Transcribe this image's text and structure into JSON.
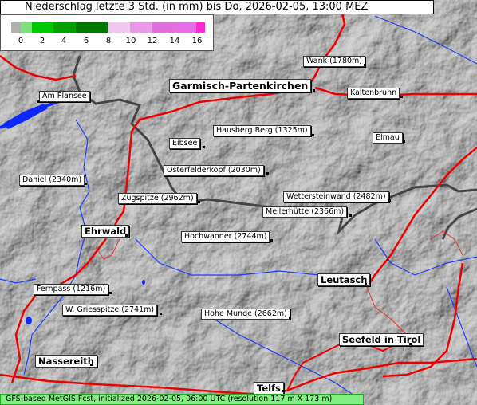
{
  "header": {
    "title": "Niederschlag letzte 3 Std. (in mm) bis Do, 2026-02-05, 13:00 MEZ"
  },
  "legend": {
    "ticks": [
      "0",
      "2",
      "4",
      "6",
      "8",
      "10",
      "12",
      "14",
      "16"
    ],
    "colors": [
      "#b0b0b0",
      "#7ee07e",
      "#00c800",
      "#00a000",
      "#007800",
      "#f0c8f0",
      "#e89ae8",
      "#e070e0",
      "#ff28d0"
    ]
  },
  "places": [
    {
      "id": "wank",
      "text": "Wank (1780m)",
      "style": "small"
    },
    {
      "id": "garmisch",
      "text": "Garmisch-Partenkirchen",
      "style": "huge"
    },
    {
      "id": "kaltenbrunn",
      "text": "Kaltenbrunn",
      "style": "small"
    },
    {
      "id": "plansee",
      "text": "Am Plansee",
      "style": "small"
    },
    {
      "id": "hausberg",
      "text": "Hausberg Berg (1325m)",
      "style": "small"
    },
    {
      "id": "eibsee",
      "text": "Eibsee",
      "style": "small"
    },
    {
      "id": "elmau",
      "text": "Elmau",
      "style": "small"
    },
    {
      "id": "osterfelder",
      "text": "Osterfelderkopf (2030m)",
      "style": "small"
    },
    {
      "id": "daniel",
      "text": "Daniel (2340m)",
      "style": "small"
    },
    {
      "id": "zugspitze",
      "text": "Zugspitze (2962m)",
      "style": "small"
    },
    {
      "id": "wetterstein",
      "text": "Wettersteinwand (2482m)",
      "style": "small"
    },
    {
      "id": "meiler",
      "text": "Meilerhütte (2366m)",
      "style": "small"
    },
    {
      "id": "ehrwald",
      "text": "Ehrwald",
      "style": "big"
    },
    {
      "id": "hochwanner",
      "text": "Hochwanner (2744m)",
      "style": "small"
    },
    {
      "id": "leutasch",
      "text": "Leutasch",
      "style": "big"
    },
    {
      "id": "fernpass",
      "text": "Fernpass (1216m)",
      "style": "small"
    },
    {
      "id": "griesspitze",
      "text": "W. Griesspitze (2741m)",
      "style": "small"
    },
    {
      "id": "hohemunde",
      "text": "Hohe Munde (2662m)",
      "style": "small"
    },
    {
      "id": "seefeld",
      "text": "Seefeld in Tirol",
      "style": "big"
    },
    {
      "id": "nassereith",
      "text": "Nassereith",
      "style": "big"
    },
    {
      "id": "telfs",
      "text": "Telfs",
      "style": "big"
    }
  ],
  "footer": {
    "text": "GFS-based MetGIS Fcst, initialized 2026-02-05, 06:00 UTC  (resolution 117 m X 173 m)"
  }
}
